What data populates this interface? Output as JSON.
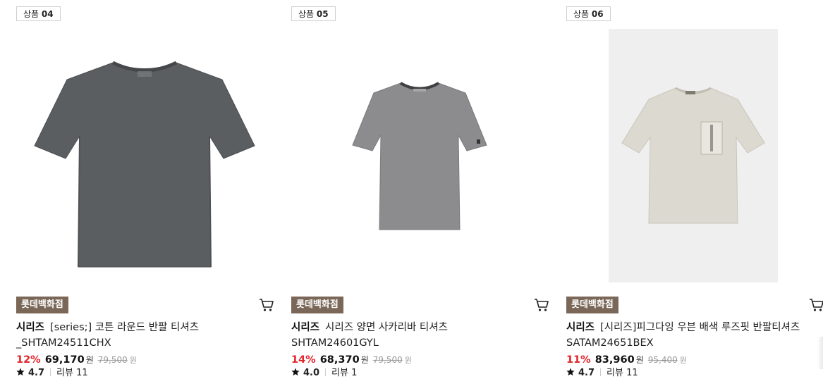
{
  "products": [
    {
      "badge_prefix": "상품",
      "badge_num": "04",
      "store": "롯데백화점",
      "brand": "시리즈",
      "title_line1": "[series;] 코튼 라운드 반팔 티셔츠",
      "title_line2": "_SHTAM24511CHX",
      "discount": "12%",
      "price": "69,170",
      "currency": "원",
      "original_price": "79,500",
      "original_currency": "원",
      "rating": "4.7",
      "review_label": "리뷰 11",
      "shirt_color": "#5b5e61"
    },
    {
      "badge_prefix": "상품",
      "badge_num": "05",
      "store": "롯데백화점",
      "brand": "시리즈",
      "title_line1": "시리즈 양면 사카리바 티셔츠",
      "title_line2": "SHTAM24601GYL",
      "discount": "14%",
      "price": "68,370",
      "currency": "원",
      "original_price": "79,500",
      "original_currency": "원",
      "rating": "4.0",
      "review_label": "리뷰 1",
      "shirt_color": "#8c8c8e"
    },
    {
      "badge_prefix": "상품",
      "badge_num": "06",
      "store": "롯데백화점",
      "brand": "시리즈",
      "title_line1": "[시리즈]피그다잉 우븐 배색 루즈핏 반팔티셔츠",
      "title_line2": "SATAM24651BEX",
      "discount": "11%",
      "price": "83,960",
      "currency": "원",
      "original_price": "95,400",
      "original_currency": "원",
      "rating": "4.7",
      "review_label": "리뷰 11",
      "shirt_color": "#dcd9d0"
    }
  ],
  "icons": {
    "cart": "cart-icon",
    "star": "star-icon"
  },
  "colors": {
    "discount": "#e4252c",
    "store_tag": "#7a6757"
  }
}
